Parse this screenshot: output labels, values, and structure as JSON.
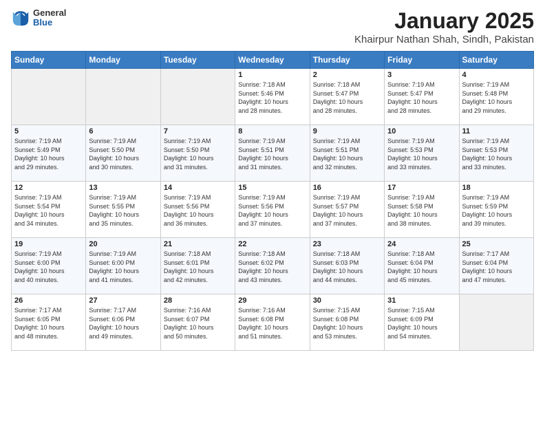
{
  "header": {
    "logo_general": "General",
    "logo_blue": "Blue",
    "month": "January 2025",
    "location": "Khairpur Nathan Shah, Sindh, Pakistan"
  },
  "calendar": {
    "days_of_week": [
      "Sunday",
      "Monday",
      "Tuesday",
      "Wednesday",
      "Thursday",
      "Friday",
      "Saturday"
    ],
    "weeks": [
      [
        {
          "day": "",
          "info": ""
        },
        {
          "day": "",
          "info": ""
        },
        {
          "day": "",
          "info": ""
        },
        {
          "day": "1",
          "info": "Sunrise: 7:18 AM\nSunset: 5:46 PM\nDaylight: 10 hours\nand 28 minutes."
        },
        {
          "day": "2",
          "info": "Sunrise: 7:18 AM\nSunset: 5:47 PM\nDaylight: 10 hours\nand 28 minutes."
        },
        {
          "day": "3",
          "info": "Sunrise: 7:19 AM\nSunset: 5:47 PM\nDaylight: 10 hours\nand 28 minutes."
        },
        {
          "day": "4",
          "info": "Sunrise: 7:19 AM\nSunset: 5:48 PM\nDaylight: 10 hours\nand 29 minutes."
        }
      ],
      [
        {
          "day": "5",
          "info": "Sunrise: 7:19 AM\nSunset: 5:49 PM\nDaylight: 10 hours\nand 29 minutes."
        },
        {
          "day": "6",
          "info": "Sunrise: 7:19 AM\nSunset: 5:50 PM\nDaylight: 10 hours\nand 30 minutes."
        },
        {
          "day": "7",
          "info": "Sunrise: 7:19 AM\nSunset: 5:50 PM\nDaylight: 10 hours\nand 31 minutes."
        },
        {
          "day": "8",
          "info": "Sunrise: 7:19 AM\nSunset: 5:51 PM\nDaylight: 10 hours\nand 31 minutes."
        },
        {
          "day": "9",
          "info": "Sunrise: 7:19 AM\nSunset: 5:51 PM\nDaylight: 10 hours\nand 32 minutes."
        },
        {
          "day": "10",
          "info": "Sunrise: 7:19 AM\nSunset: 5:53 PM\nDaylight: 10 hours\nand 33 minutes."
        },
        {
          "day": "11",
          "info": "Sunrise: 7:19 AM\nSunset: 5:53 PM\nDaylight: 10 hours\nand 33 minutes."
        }
      ],
      [
        {
          "day": "12",
          "info": "Sunrise: 7:19 AM\nSunset: 5:54 PM\nDaylight: 10 hours\nand 34 minutes."
        },
        {
          "day": "13",
          "info": "Sunrise: 7:19 AM\nSunset: 5:55 PM\nDaylight: 10 hours\nand 35 minutes."
        },
        {
          "day": "14",
          "info": "Sunrise: 7:19 AM\nSunset: 5:56 PM\nDaylight: 10 hours\nand 36 minutes."
        },
        {
          "day": "15",
          "info": "Sunrise: 7:19 AM\nSunset: 5:56 PM\nDaylight: 10 hours\nand 37 minutes."
        },
        {
          "day": "16",
          "info": "Sunrise: 7:19 AM\nSunset: 5:57 PM\nDaylight: 10 hours\nand 37 minutes."
        },
        {
          "day": "17",
          "info": "Sunrise: 7:19 AM\nSunset: 5:58 PM\nDaylight: 10 hours\nand 38 minutes."
        },
        {
          "day": "18",
          "info": "Sunrise: 7:19 AM\nSunset: 5:59 PM\nDaylight: 10 hours\nand 39 minutes."
        }
      ],
      [
        {
          "day": "19",
          "info": "Sunrise: 7:19 AM\nSunset: 6:00 PM\nDaylight: 10 hours\nand 40 minutes."
        },
        {
          "day": "20",
          "info": "Sunrise: 7:19 AM\nSunset: 6:00 PM\nDaylight: 10 hours\nand 41 minutes."
        },
        {
          "day": "21",
          "info": "Sunrise: 7:18 AM\nSunset: 6:01 PM\nDaylight: 10 hours\nand 42 minutes."
        },
        {
          "day": "22",
          "info": "Sunrise: 7:18 AM\nSunset: 6:02 PM\nDaylight: 10 hours\nand 43 minutes."
        },
        {
          "day": "23",
          "info": "Sunrise: 7:18 AM\nSunset: 6:03 PM\nDaylight: 10 hours\nand 44 minutes."
        },
        {
          "day": "24",
          "info": "Sunrise: 7:18 AM\nSunset: 6:04 PM\nDaylight: 10 hours\nand 45 minutes."
        },
        {
          "day": "25",
          "info": "Sunrise: 7:17 AM\nSunset: 6:04 PM\nDaylight: 10 hours\nand 47 minutes."
        }
      ],
      [
        {
          "day": "26",
          "info": "Sunrise: 7:17 AM\nSunset: 6:05 PM\nDaylight: 10 hours\nand 48 minutes."
        },
        {
          "day": "27",
          "info": "Sunrise: 7:17 AM\nSunset: 6:06 PM\nDaylight: 10 hours\nand 49 minutes."
        },
        {
          "day": "28",
          "info": "Sunrise: 7:16 AM\nSunset: 6:07 PM\nDaylight: 10 hours\nand 50 minutes."
        },
        {
          "day": "29",
          "info": "Sunrise: 7:16 AM\nSunset: 6:08 PM\nDaylight: 10 hours\nand 51 minutes."
        },
        {
          "day": "30",
          "info": "Sunrise: 7:15 AM\nSunset: 6:08 PM\nDaylight: 10 hours\nand 53 minutes."
        },
        {
          "day": "31",
          "info": "Sunrise: 7:15 AM\nSunset: 6:09 PM\nDaylight: 10 hours\nand 54 minutes."
        },
        {
          "day": "",
          "info": ""
        }
      ]
    ]
  }
}
